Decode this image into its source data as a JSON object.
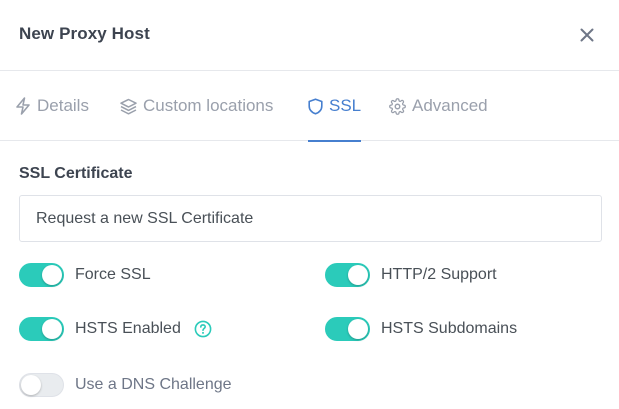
{
  "modal": {
    "title": "New Proxy Host",
    "close_icon": "close-icon"
  },
  "tabs": [
    {
      "label": "Details",
      "icon": "lightning-icon",
      "active": false
    },
    {
      "label": "Custom locations",
      "icon": "layers-icon",
      "active": false
    },
    {
      "label": "SSL",
      "icon": "shield-icon",
      "active": true
    },
    {
      "label": "Advanced",
      "icon": "gear-icon",
      "active": false
    }
  ],
  "ssl": {
    "section_label": "SSL Certificate",
    "certificate_value": "Request a new SSL Certificate",
    "options": [
      {
        "label": "Force SSL",
        "enabled": true
      },
      {
        "label": "HTTP/2 Support",
        "enabled": true
      },
      {
        "label": "HSTS Enabled",
        "enabled": true,
        "help_icon": "help-circle-icon"
      },
      {
        "label": "HSTS Subdomains",
        "enabled": true
      },
      {
        "label": "Use a DNS Challenge",
        "enabled": false
      }
    ]
  },
  "colors": {
    "accent": "#467fcf",
    "switch_on": "#2bcbba",
    "muted_text": "#9aa0ac"
  }
}
